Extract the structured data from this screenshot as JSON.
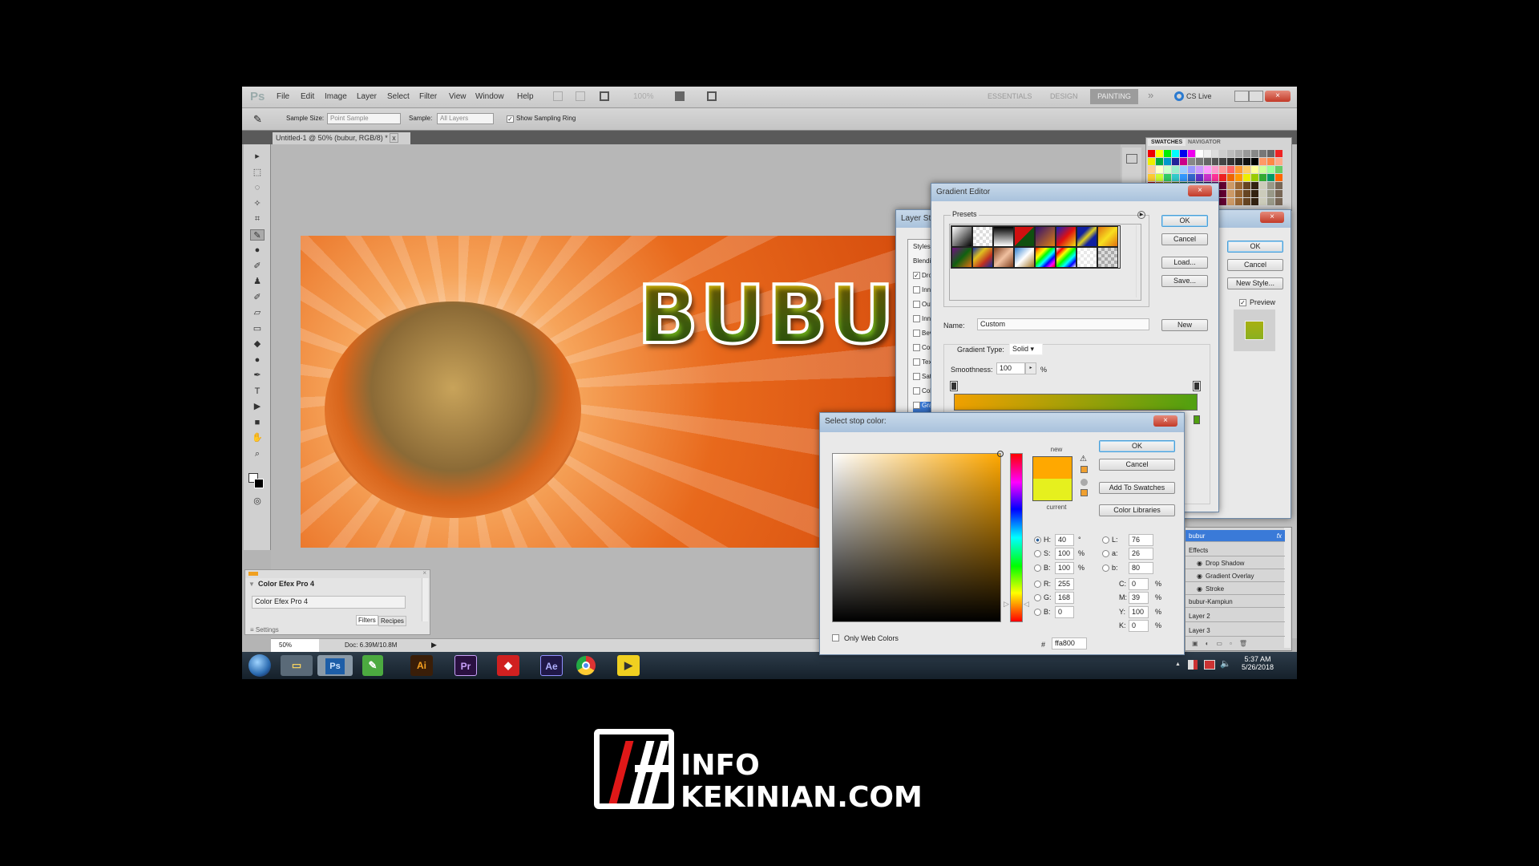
{
  "app": {
    "logo": "Ps",
    "menu": [
      "File",
      "Edit",
      "Image",
      "Layer",
      "Select",
      "Filter",
      "View",
      "Window",
      "Help"
    ],
    "zoom_readout": "100%",
    "workspaces": [
      "ESSENTIALS",
      "DESIGN",
      "PAINTING"
    ],
    "active_workspace": "PAINTING",
    "more": "»",
    "cs_live": "CS Live"
  },
  "options": {
    "sample_size_label": "Sample Size:",
    "sample_size": "Point Sample",
    "sample_label": "Sample:",
    "sample": "All Layers",
    "show_ring_label": "Show Sampling Ring",
    "show_ring": true
  },
  "document": {
    "tab": "Untitled-1 @ 50% (bubur, RGB/8) *",
    "close": "x",
    "artwork_text": "BUBUR",
    "zoom": "50%",
    "doc_size": "Doc: 6.39M/10.8M"
  },
  "swatches_panel": {
    "tabs": [
      "SWATCHES",
      "NAVIGATOR"
    ]
  },
  "efex": {
    "title": "Color Efex Pro 4",
    "item": "Color Efex Pro 4",
    "tabs": [
      "Filters",
      "Recipes"
    ],
    "settings": "Settings"
  },
  "layer_style": {
    "title": "Layer Style",
    "items": [
      {
        "label": "Styles"
      },
      {
        "label": "Blending Options: Default"
      },
      {
        "label": "Drop Shadow",
        "checked": true
      },
      {
        "label": "Inner Shadow",
        "checked": false
      },
      {
        "label": "Outer Glow",
        "checked": false
      },
      {
        "label": "Inner Glow",
        "checked": false
      },
      {
        "label": "Bevel and Emboss",
        "checked": false
      },
      {
        "label": "Contour",
        "checked": false
      },
      {
        "label": "Texture",
        "checked": false
      },
      {
        "label": "Satin",
        "checked": false
      },
      {
        "label": "Color Overlay",
        "checked": false
      },
      {
        "label": "Gradient Overlay",
        "checked": true
      }
    ],
    "ok": "OK",
    "cancel": "Cancel",
    "new_style": "New Style...",
    "preview_label": "Preview",
    "preview": true,
    "preview_color": "#a8b010"
  },
  "gradient_editor": {
    "title": "Gradient Editor",
    "presets_label": "Presets",
    "presets": [
      "linear-gradient(135deg,#fff,#000)",
      "repeating-conic-gradient(#ddd 0 25%,#fff 0 50%) 0 0/8px 8px",
      "linear-gradient(#000,#fff)",
      "linear-gradient(135deg,#d01010 50%,#105010 50%)",
      "linear-gradient(135deg,#301070,#e08010)",
      "linear-gradient(135deg,#1020c0,#e01010,#f0e010)",
      "linear-gradient(135deg,#1020a0 30%,#e0d020 50%,#1020a0 70%)",
      "linear-gradient(135deg,#e07010,#f8e020,#e07010)",
      "linear-gradient(135deg,#701080,#106010,#e07010)",
      "linear-gradient(135deg,#1030a0,#e0c020,#c03020,#1030a0)",
      "linear-gradient(135deg,#804020,#f0c0a0,#804020)",
      "linear-gradient(135deg,#3080d0,#fff 50%,#a07020)",
      "linear-gradient(135deg,red,orange,yellow,lime,cyan,blue,magenta,red)",
      "linear-gradient(135deg,#fff,red,yellow,lime,cyan,blue,#fff)",
      "repeating-conic-gradient(#e8e8e8 0 25%,#fff 0 50%) 0 0/8px 8px",
      "repeating-conic-gradient(#aaa 0 25%,#ddd 0 50%) 0 0/8px 8px"
    ],
    "ok": "OK",
    "cancel": "Cancel",
    "load": "Load...",
    "save": "Save...",
    "name_label": "Name:",
    "name": "Custom",
    "new": "New",
    "type_label": "Gradient Type:",
    "type": "Solid",
    "smoothness_label": "Smoothness:",
    "smoothness": "100",
    "smoothness_unit": "%",
    "gradient_colors": [
      "#f0a000",
      "#50a010"
    ]
  },
  "stop_color": {
    "title": "Select stop color:",
    "new_label": "new",
    "current_label": "current",
    "new_color": "#ffa800",
    "current_color": "#e6f01e",
    "ok": "OK",
    "cancel": "Cancel",
    "add_swatches": "Add To Swatches",
    "libraries": "Color Libraries",
    "only_web": "Only Web Colors",
    "fields": {
      "H": "40",
      "S": "100",
      "Bv": "100",
      "R": "255",
      "G": "168",
      "B": "0",
      "L": "76",
      "a": "26",
      "b": "80",
      "C": "0",
      "M": "39",
      "Y": "100",
      "K": "0"
    },
    "units": {
      "deg": "°",
      "pct": "%"
    },
    "hex_label": "#",
    "hex": "ffa800",
    "selected": "H"
  },
  "layers": {
    "rows": [
      "bubur",
      "Effects",
      "Drop Shadow",
      "Gradient Overlay",
      "Stroke",
      "bubur-Kampiun",
      "Layer 2",
      "Layer 3"
    ],
    "fx": "fx"
  },
  "taskbar": {
    "apps": [
      "Ps",
      "Ai",
      "Pr",
      "Ae"
    ],
    "time": "5:37 AM",
    "date": "5/26/2018"
  },
  "watermark": {
    "line1": "INFO",
    "line2": "KEKINIAN.COM"
  }
}
